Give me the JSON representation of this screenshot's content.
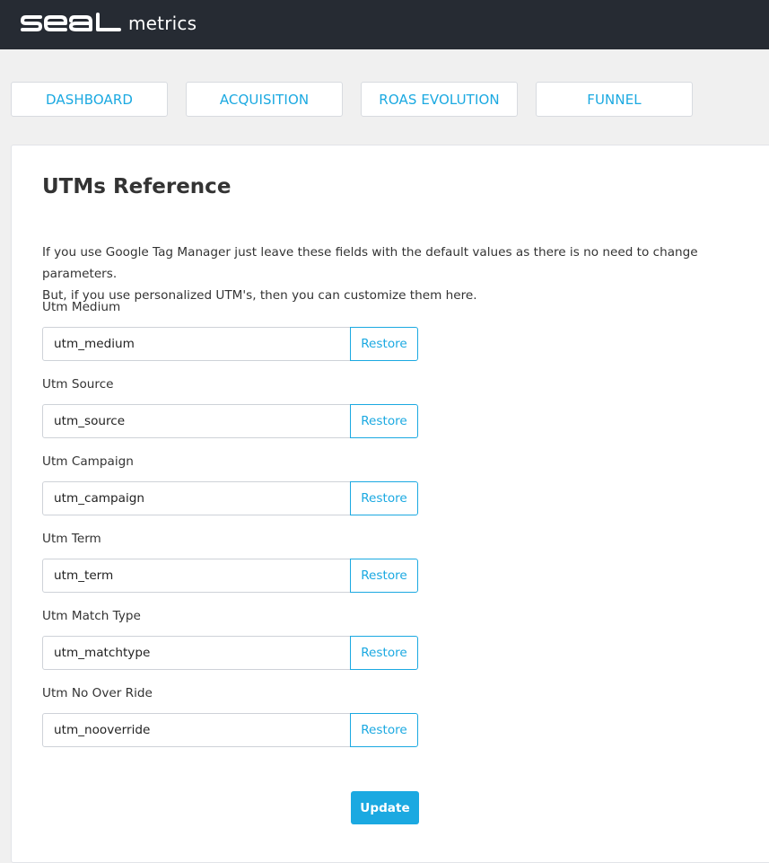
{
  "header": {
    "logo_word": "SEAL",
    "logo_suffix": "metrics",
    "background": "#262b33"
  },
  "tabs": [
    {
      "label": "DASHBOARD"
    },
    {
      "label": "ACQUISITION"
    },
    {
      "label": "ROAS EVOLUTION"
    },
    {
      "label": "FUNNEL"
    }
  ],
  "page": {
    "title": "UTMs Reference",
    "description_line1": "If you use Google Tag Manager just leave these fields with the default values as there is no need to change parameters.",
    "description_line2": "But, if you use personalized UTM's, then you can customize them here."
  },
  "fields": [
    {
      "label": "Utm Medium",
      "value": "utm_medium",
      "button": "Restore"
    },
    {
      "label": "Utm Source",
      "value": "utm_source",
      "button": "Restore"
    },
    {
      "label": "Utm Campaign",
      "value": "utm_campaign",
      "button": "Restore"
    },
    {
      "label": "Utm Term",
      "value": "utm_term",
      "button": "Restore"
    },
    {
      "label": "Utm Match Type",
      "value": "utm_matchtype",
      "button": "Restore"
    },
    {
      "label": "Utm No Over Ride",
      "value": "utm_nooverride",
      "button": "Restore"
    }
  ],
  "actions": {
    "update_label": "Update"
  },
  "colors": {
    "accent": "#1ba9e1",
    "page_bg": "#f0f0f0",
    "card_bg": "#ffffff"
  }
}
